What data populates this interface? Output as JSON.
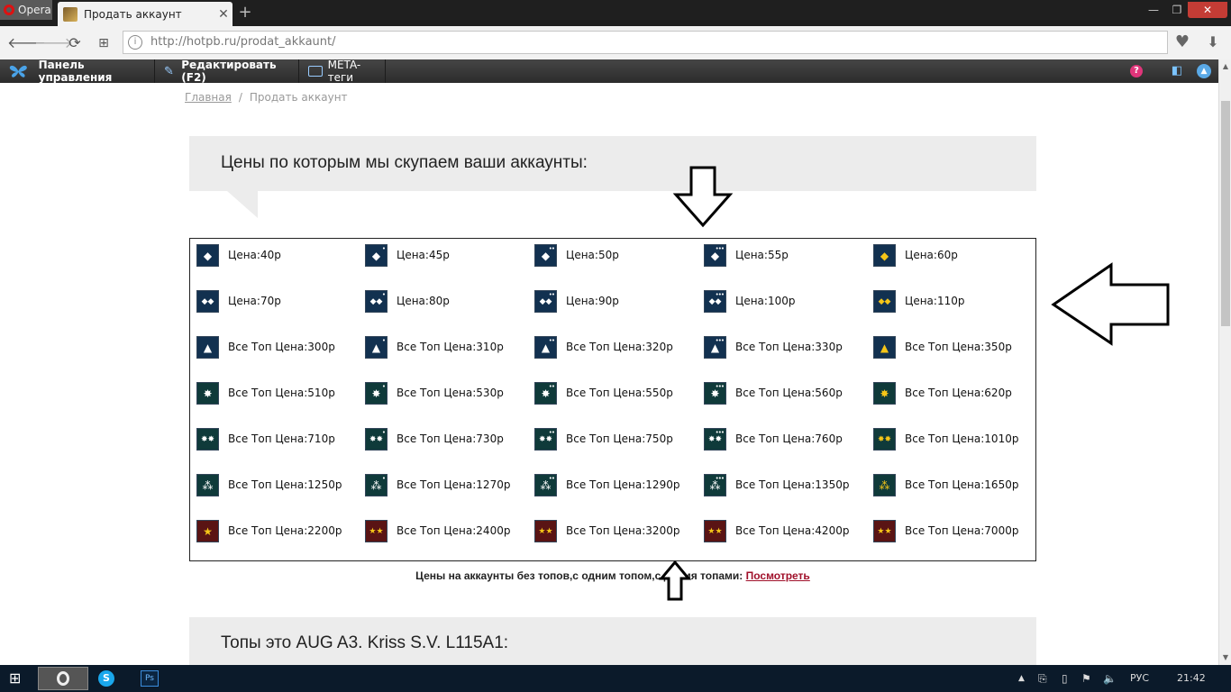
{
  "browser": {
    "menu_label": "Opera",
    "tab_title": "Продать аккаунт",
    "tab_close": "✕",
    "new_tab": "+",
    "url": "http://hotpb.ru/prodat_akkaunt/"
  },
  "adminbar": {
    "dashboard": "Панель управления",
    "edit": "Редактировать (F2)",
    "meta": "META-теги",
    "help": "?"
  },
  "breadcrumb": {
    "home": "Главная",
    "separator": "/",
    "current": "Продать аккаунт"
  },
  "section1": {
    "title": "Цены по которым мы скупаем ваши аккаунты:"
  },
  "ranks": [
    {
      "label": "Цена:40р",
      "symbol": "◆",
      "pips": "",
      "bg": "#123150",
      "color": "#ffffff"
    },
    {
      "label": "Цена:45р",
      "symbol": "◆",
      "pips": "•",
      "bg": "#123150",
      "color": "#ffffff"
    },
    {
      "label": "Цена:50р",
      "symbol": "◆",
      "pips": "••",
      "bg": "#123150",
      "color": "#ffffff"
    },
    {
      "label": "Цена:55р",
      "symbol": "◆",
      "pips": "•••",
      "bg": "#123150",
      "color": "#ffffff"
    },
    {
      "label": "Цена:60р",
      "symbol": "◆",
      "pips": "",
      "bg": "#123150",
      "color": "#f5c518"
    },
    {
      "label": "Цена:70р",
      "symbol": "◆◆",
      "pips": "",
      "bg": "#123150",
      "color": "#ffffff"
    },
    {
      "label": "Цена:80р",
      "symbol": "◆◆",
      "pips": "•",
      "bg": "#123150",
      "color": "#ffffff"
    },
    {
      "label": "Цена:90р",
      "symbol": "◆◆",
      "pips": "••",
      "bg": "#123150",
      "color": "#ffffff"
    },
    {
      "label": "Цена:100р",
      "symbol": "◆◆",
      "pips": "•••",
      "bg": "#123150",
      "color": "#ffffff"
    },
    {
      "label": "Цена:110р",
      "symbol": "◆◆",
      "pips": "",
      "bg": "#123150",
      "color": "#f5c518"
    },
    {
      "label": "Все Топ Цена:300р",
      "symbol": "▲",
      "pips": "",
      "bg": "#123150",
      "color": "#ffffff"
    },
    {
      "label": "Все Топ Цена:310р",
      "symbol": "▲",
      "pips": "•",
      "bg": "#123150",
      "color": "#ffffff"
    },
    {
      "label": "Все Топ Цена:320р",
      "symbol": "▲",
      "pips": "••",
      "bg": "#123150",
      "color": "#ffffff"
    },
    {
      "label": "Все Топ Цена:330р",
      "symbol": "▲",
      "pips": "•••",
      "bg": "#123150",
      "color": "#ffffff"
    },
    {
      "label": "Все Топ Цена:350р",
      "symbol": "▲",
      "pips": "",
      "bg": "#123150",
      "color": "#f5c518"
    },
    {
      "label": "Все Топ Цена:510р",
      "symbol": "✸",
      "pips": "",
      "bg": "#0f3a3a",
      "color": "#ffffff"
    },
    {
      "label": "Все Топ Цена:530р",
      "symbol": "✸",
      "pips": "•",
      "bg": "#0f3a3a",
      "color": "#ffffff"
    },
    {
      "label": "Все Топ Цена:550р",
      "symbol": "✸",
      "pips": "••",
      "bg": "#0f3a3a",
      "color": "#ffffff"
    },
    {
      "label": "Все Топ Цена:560р",
      "symbol": "✸",
      "pips": "•••",
      "bg": "#0f3a3a",
      "color": "#ffffff"
    },
    {
      "label": "Все Топ Цена:620р",
      "symbol": "✸",
      "pips": "",
      "bg": "#0f3a3a",
      "color": "#f5c518"
    },
    {
      "label": "Все Топ Цена:710р",
      "symbol": "✸✸",
      "pips": "",
      "bg": "#0f3a3a",
      "color": "#ffffff"
    },
    {
      "label": "Все Топ Цена:730р",
      "symbol": "✸✸",
      "pips": "•",
      "bg": "#0f3a3a",
      "color": "#ffffff"
    },
    {
      "label": "Все Топ Цена:750р",
      "symbol": "✸✸",
      "pips": "••",
      "bg": "#0f3a3a",
      "color": "#ffffff"
    },
    {
      "label": "Все Топ Цена:760р",
      "symbol": "✸✸",
      "pips": "•••",
      "bg": "#0f3a3a",
      "color": "#ffffff"
    },
    {
      "label": "Все Топ Цена:1010р",
      "symbol": "✸✸",
      "pips": "",
      "bg": "#0f3a3a",
      "color": "#f5c518"
    },
    {
      "label": "Все Топ Цена:1250р",
      "symbol": "⁂",
      "pips": "",
      "bg": "#0f3a3a",
      "color": "#ffffff"
    },
    {
      "label": "Все Топ Цена:1270р",
      "symbol": "⁂",
      "pips": "•",
      "bg": "#0f3a3a",
      "color": "#ffffff"
    },
    {
      "label": "Все Топ Цена:1290р",
      "symbol": "⁂",
      "pips": "••",
      "bg": "#0f3a3a",
      "color": "#ffffff"
    },
    {
      "label": "Все Топ Цена:1350р",
      "symbol": "⁂",
      "pips": "•••",
      "bg": "#0f3a3a",
      "color": "#ffffff"
    },
    {
      "label": "Все Топ Цена:1650р",
      "symbol": "⁂",
      "pips": "",
      "bg": "#0f3a3a",
      "color": "#f5c518"
    },
    {
      "label": "Все Топ Цена:2200р",
      "symbol": "★",
      "pips": "",
      "bg": "#5a1414",
      "color": "#f5c518"
    },
    {
      "label": "Все Топ Цена:2400р",
      "symbol": "★★",
      "pips": "",
      "bg": "#5a1414",
      "color": "#f5c518"
    },
    {
      "label": "Все Топ Цена:3200р",
      "symbol": "★★",
      "pips": "",
      "bg": "#5a1414",
      "color": "#f5c518"
    },
    {
      "label": "Все Топ Цена:4200р",
      "symbol": "★★",
      "pips": "",
      "bg": "#5a1414",
      "color": "#f5c518"
    },
    {
      "label": "Все Топ Цена:7000р",
      "symbol": "★★",
      "pips": "",
      "bg": "#5a1414",
      "color": "#f5c518"
    }
  ],
  "note": {
    "text": "Цены на аккаунты без топов,с одним топом,с двумя топами: ",
    "link": "Посмотреть"
  },
  "section2": {
    "title": "Топы это AUG A3. Kriss S.V. L115A1:"
  },
  "taskbar": {
    "language": "РУС",
    "clock": "21:42"
  },
  "colors": {
    "link_accent": "#a0102a",
    "section_bg": "#ececec",
    "adminbar_bg": "#2b2b2b"
  }
}
